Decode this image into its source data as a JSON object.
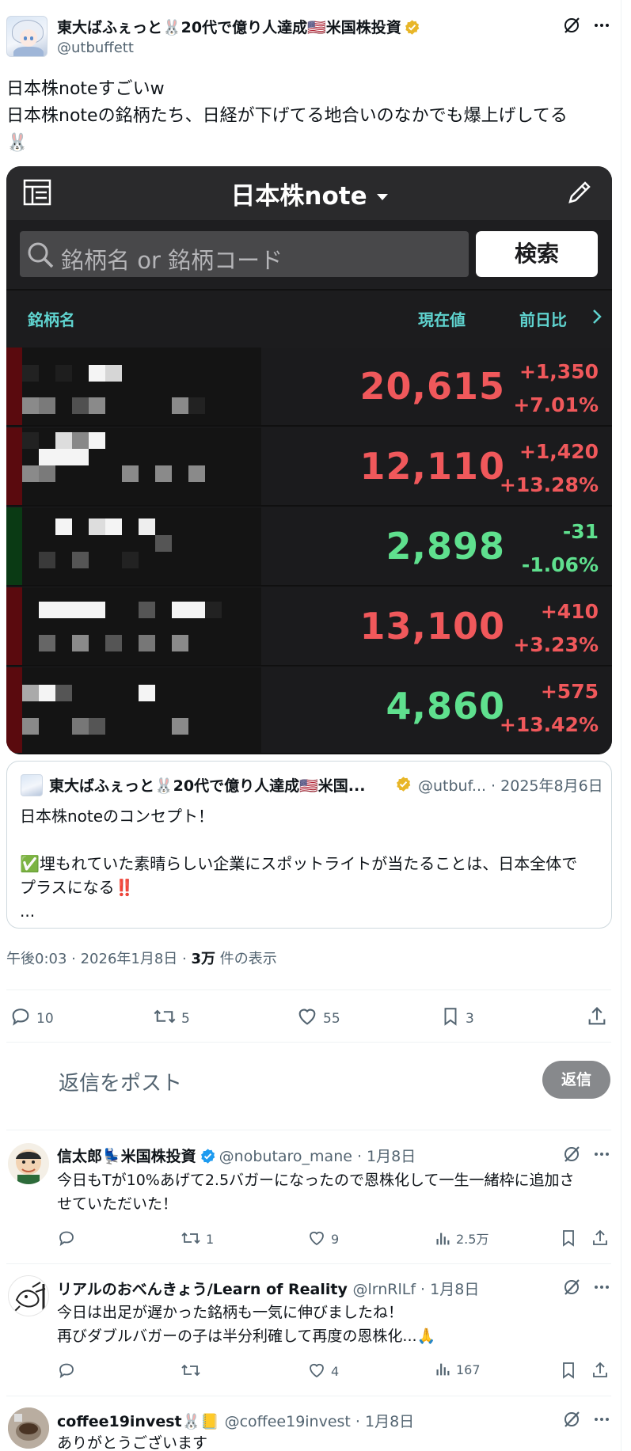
{
  "post": {
    "author_name": "東大ばふぇっと🐰20代で億り人達成🇺🇸米国株投資",
    "author_handle": "@utbuffett",
    "text_lines": [
      "日本株noteすごいw",
      "日本株noteの銘柄たち、日経が下げてる地合いのなかでも爆上げしてる",
      "🐰"
    ],
    "timestamp_prefix": "午後0:03 · 2026年1月8日 · ",
    "views_count": "3万",
    "views_suffix": " 件の表示",
    "actions": {
      "replies": "10",
      "reposts": "5",
      "likes": "55",
      "bookmarks": "3"
    }
  },
  "app": {
    "title": "日本株note",
    "search_placeholder": "銘柄名 or 銘柄コード",
    "search_button": "検索",
    "columns": {
      "name": "銘柄名",
      "price": "現在値",
      "change": "前日比"
    },
    "rows": [
      {
        "price": "20,615",
        "change": "+1,350",
        "pct": "+7.01%",
        "direction": "up"
      },
      {
        "price": "12,110",
        "change": "+1,420",
        "pct": "+13.28%",
        "direction": "up"
      },
      {
        "price": "2,898",
        "change": "-31",
        "pct": "-1.06%",
        "direction": "down"
      },
      {
        "price": "13,100",
        "change": "+410",
        "pct": "+3.23%",
        "direction": "up"
      },
      {
        "price": "4,860",
        "change": "+575",
        "pct": "+13.42%",
        "direction": "up"
      }
    ],
    "colors": {
      "up": "#f0585b",
      "down": "#5fe08e",
      "accent": "#5fd3cf"
    }
  },
  "quote": {
    "author_name": "東大ばふぇっと🐰20代で億り人達成🇺🇸米国...",
    "meta": "@utbuf... · 2025年8月6日",
    "line1": "日本株noteのコンセプト！",
    "line2": "✅埋もれていた素晴らしい企業にスポットライトが当たることは、日本全体で",
    "line3": "プラスになる‼️",
    "line4": "..."
  },
  "composer": {
    "placeholder": "返信をポスト",
    "button": "返信"
  },
  "replies": [
    {
      "name": "信太郎💺米国株投資",
      "meta": "@nobutaro_mane · 1月8日",
      "lines": [
        "今日もTが10%あげて2.5バガーになったので恩株化して一生一緒枠に追加さ",
        "せていただいた！"
      ],
      "retweets": "1",
      "likes": "9",
      "views": "2.5万"
    },
    {
      "name": "リアルのおべんきょう/Learn of Reality",
      "meta": "@lrnRlLf · 1月8日",
      "lines": [
        "今日は出足が遅かった銘柄も一気に伸びましたね！",
        "再びダブルバガーの子は半分利確して再度の恩株化...🙏"
      ],
      "retweets": "",
      "likes": "4",
      "views": "167"
    },
    {
      "name": "coffee19invest🐰📒",
      "meta": "@coffee19invest · 1月8日",
      "lines": [
        "ありがとうございます"
      ]
    }
  ]
}
